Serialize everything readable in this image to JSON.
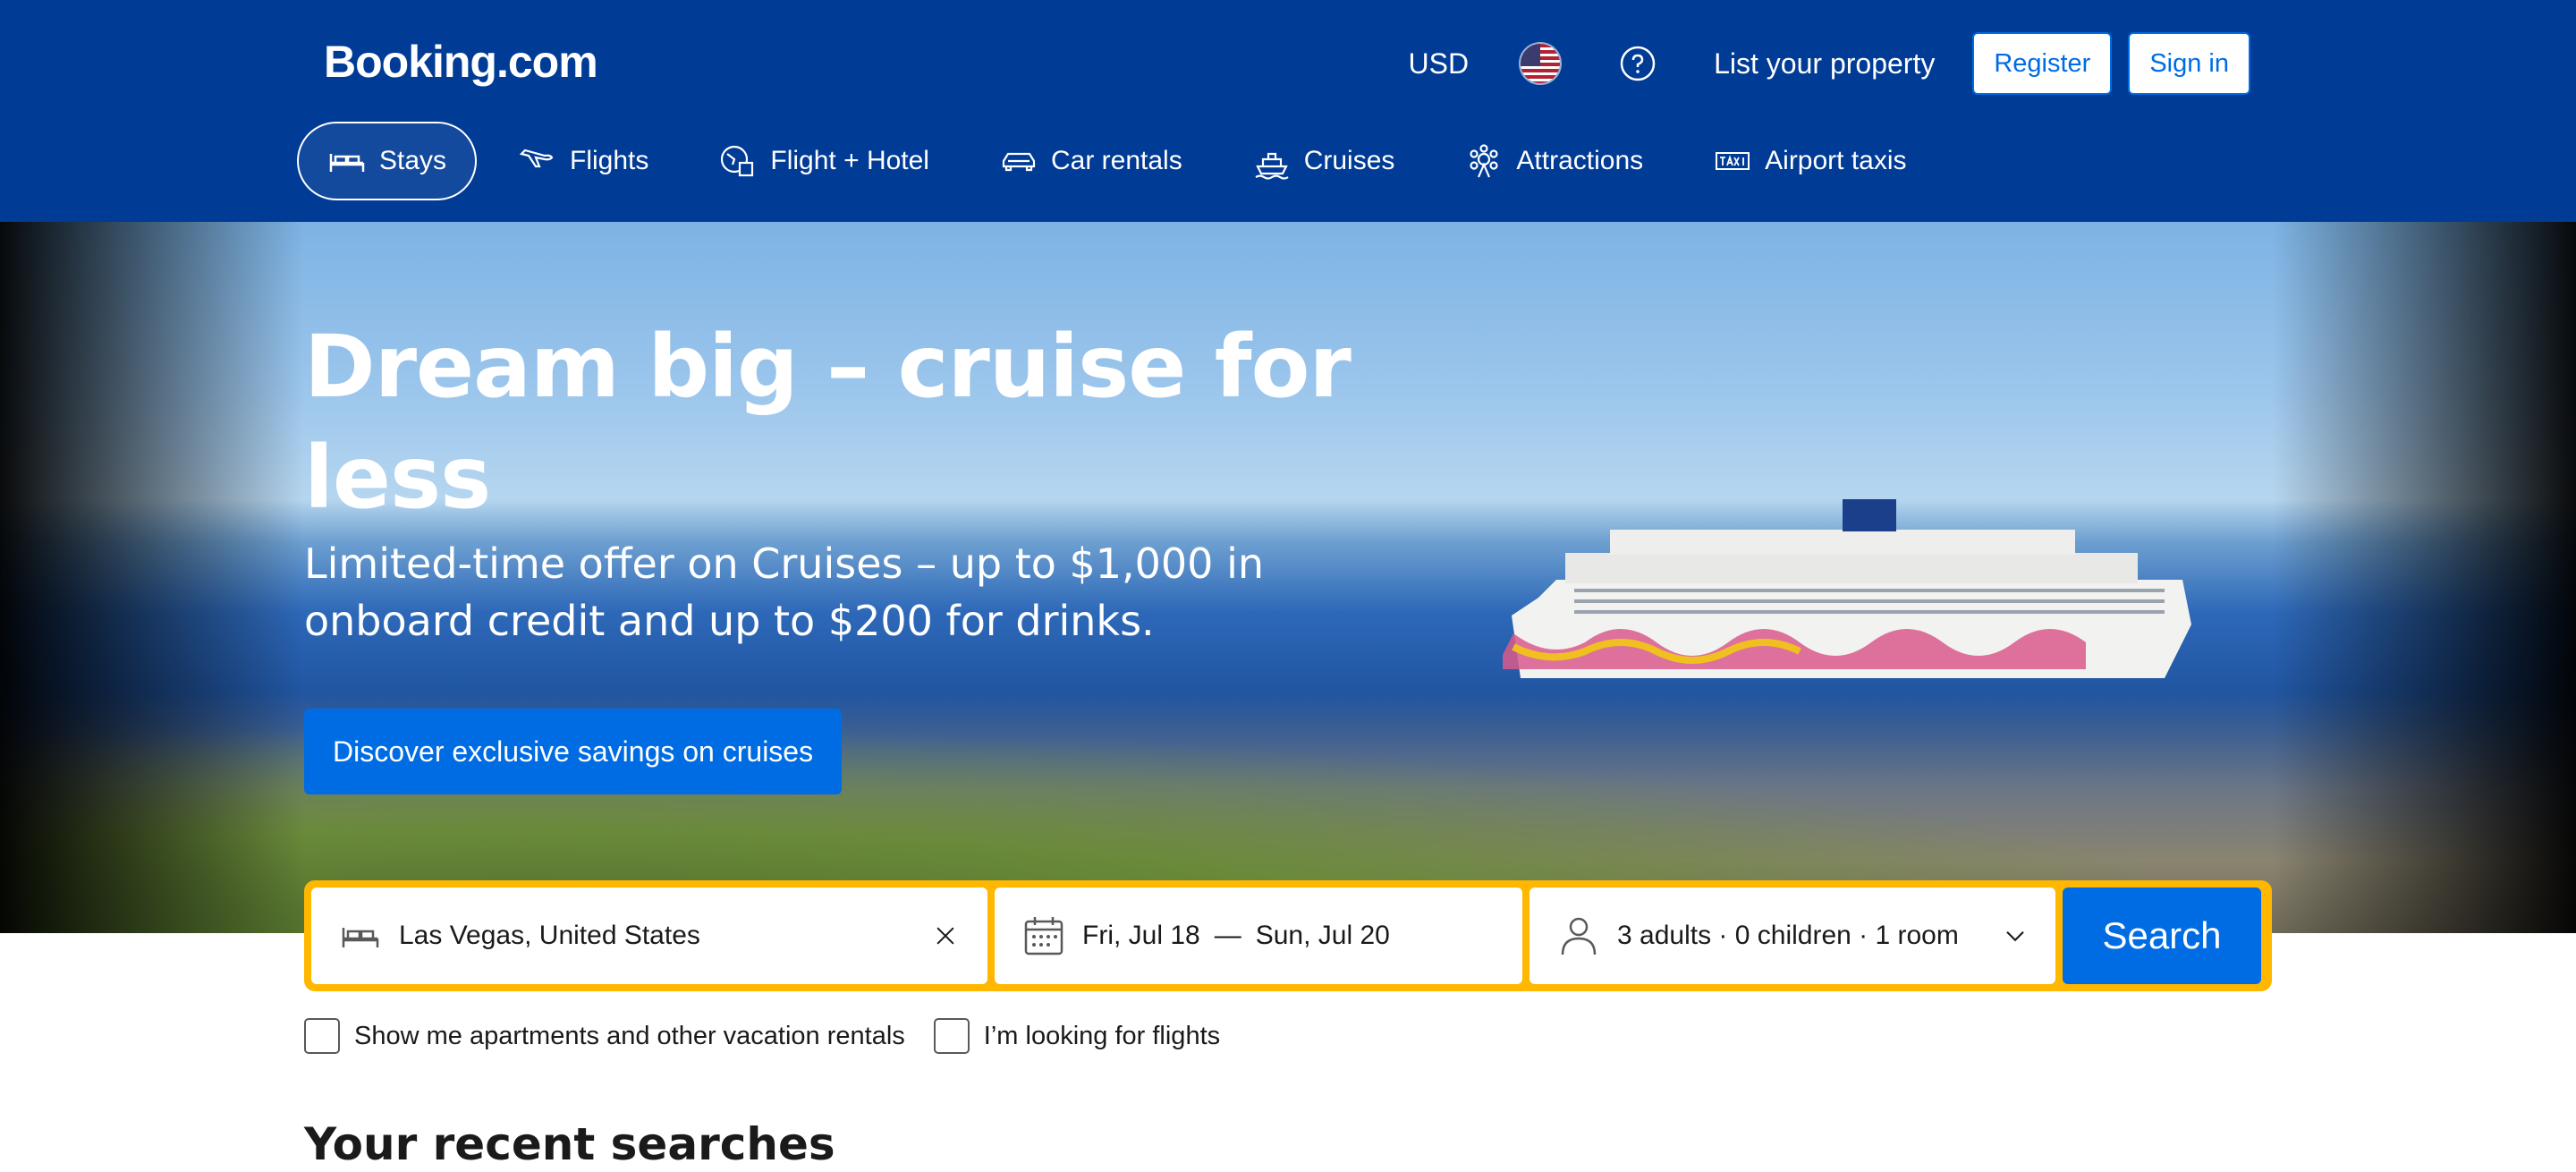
{
  "header": {
    "logo": "Booking.com",
    "currency": "USD",
    "list_property": "List your property",
    "register": "Register",
    "sign_in": "Sign in"
  },
  "nav": [
    {
      "label": "Stays",
      "icon": "bed-icon",
      "active": true
    },
    {
      "label": "Flights",
      "icon": "plane-icon"
    },
    {
      "label": "Flight + Hotel",
      "icon": "flight-hotel-icon"
    },
    {
      "label": "Car rentals",
      "icon": "car-icon"
    },
    {
      "label": "Cruises",
      "icon": "ship-icon"
    },
    {
      "label": "Attractions",
      "icon": "attractions-icon"
    },
    {
      "label": "Airport taxis",
      "icon": "taxi-icon"
    }
  ],
  "hero": {
    "headline": "Dream big – cruise for less",
    "subline": "Limited-time offer on Cruises – up to $1,000 in onboard credit and up to $200 for drinks.",
    "cta": "Discover exclusive savings on cruises"
  },
  "search": {
    "destination": "Las Vegas, United States",
    "checkin": "Fri, Jul 18",
    "date_separator": "—",
    "checkout": "Sun, Jul 20",
    "guests": "3 adults · 0 children · 1 room",
    "button": "Search"
  },
  "options": {
    "apartments": "Show me apartments and other vacation rentals",
    "flights": "I’m looking for flights"
  },
  "recent_title": "Your recent searches",
  "colors": {
    "brand": "#003b95",
    "action": "#006ce4",
    "highlight": "#ffb700"
  }
}
